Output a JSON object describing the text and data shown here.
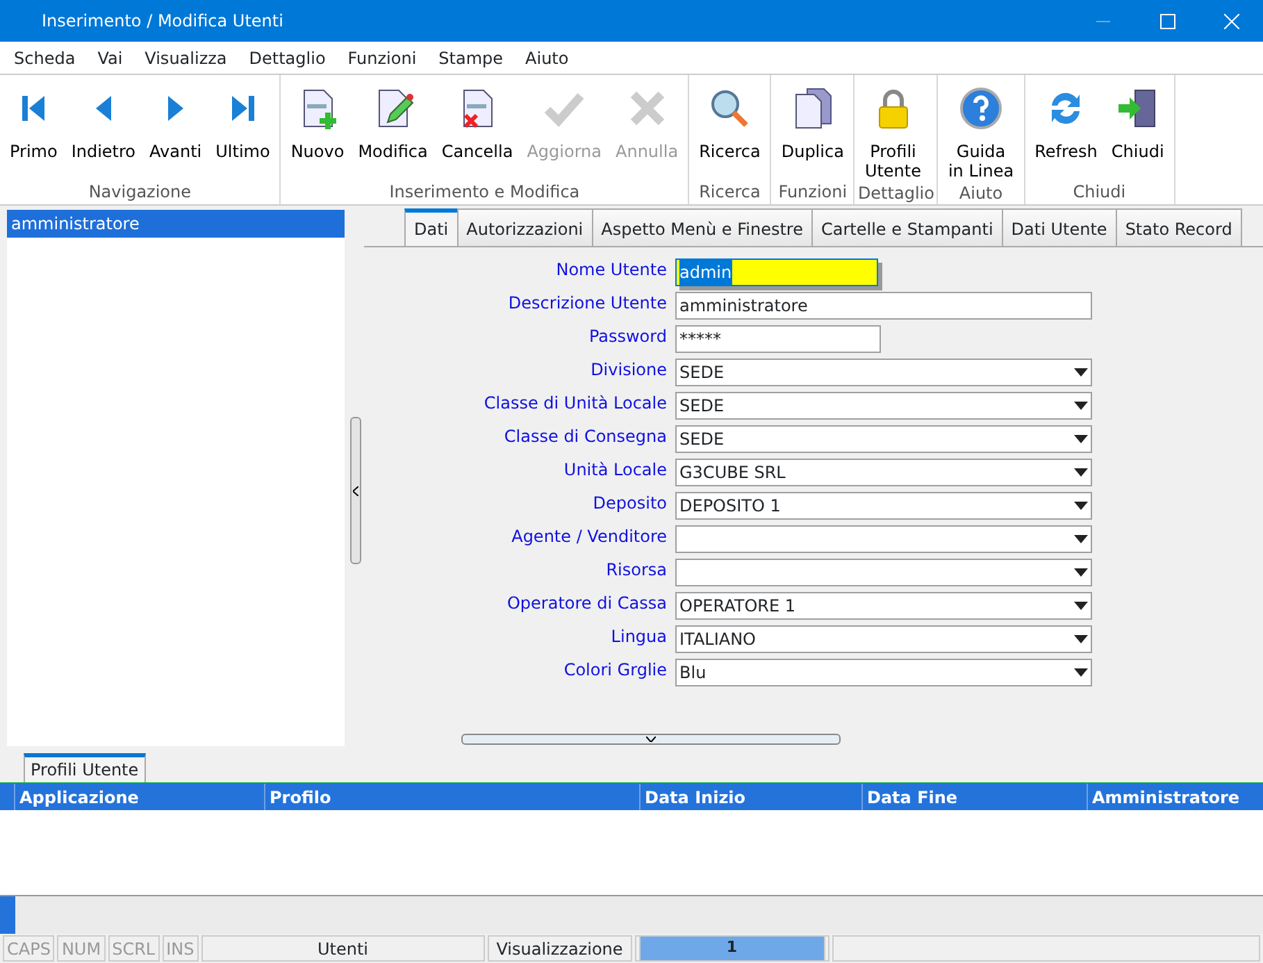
{
  "window": {
    "title": "Inserimento / Modifica Utenti"
  },
  "menu": [
    "Scheda",
    "Vai",
    "Visualizza",
    "Dettaglio",
    "Funzioni",
    "Stampe",
    "Aiuto"
  ],
  "ribbon": [
    {
      "label": "Navigazione",
      "buttons": [
        {
          "label": "Primo",
          "kind": "first",
          "disabled": false
        },
        {
          "label": "Indietro",
          "kind": "prev",
          "disabled": false
        },
        {
          "label": "Avanti",
          "kind": "next",
          "disabled": false
        },
        {
          "label": "Ultimo",
          "kind": "last",
          "disabled": false
        }
      ]
    },
    {
      "label": "Inserimento e Modifica",
      "buttons": [
        {
          "label": "Nuovo",
          "kind": "new",
          "disabled": false
        },
        {
          "label": "Modifica",
          "kind": "edit",
          "disabled": false
        },
        {
          "label": "Cancella",
          "kind": "delete",
          "disabled": false
        },
        {
          "label": "Aggiorna",
          "kind": "check",
          "disabled": true
        },
        {
          "label": "Annulla",
          "kind": "cross",
          "disabled": true
        }
      ]
    },
    {
      "label": "Ricerca",
      "buttons": [
        {
          "label": "Ricerca",
          "kind": "search",
          "disabled": false
        }
      ]
    },
    {
      "label": "Funzioni",
      "buttons": [
        {
          "label": "Duplica",
          "kind": "duplicate",
          "disabled": false
        }
      ]
    },
    {
      "label": "Dettaglio",
      "buttons": [
        {
          "label": "Profili\nUtente",
          "kind": "lock",
          "disabled": false
        }
      ]
    },
    {
      "label": "Aiuto",
      "buttons": [
        {
          "label": "Guida\nin Linea",
          "kind": "help",
          "disabled": false
        }
      ]
    },
    {
      "label": "Chiudi",
      "buttons": [
        {
          "label": "Refresh",
          "kind": "refresh",
          "disabled": false
        },
        {
          "label": "Chiudi",
          "kind": "exit",
          "disabled": false
        }
      ]
    }
  ],
  "user_list": [
    {
      "label": "amministratore",
      "selected": true
    }
  ],
  "tabs": [
    {
      "label": "Dati",
      "selected": true
    },
    {
      "label": "Autorizzazioni",
      "selected": false
    },
    {
      "label": "Aspetto Menù e Finestre",
      "selected": false
    },
    {
      "label": "Cartelle e Stampanti",
      "selected": false
    },
    {
      "label": "Dati Utente",
      "selected": false
    },
    {
      "label": "Stato Record",
      "selected": false
    }
  ],
  "fields": [
    {
      "label": "Nome Utente",
      "value": "admin",
      "kind": "focused"
    },
    {
      "label": "Descrizione Utente",
      "value": "amministratore",
      "kind": "text"
    },
    {
      "label": "Password",
      "value": "*****",
      "kind": "password"
    },
    {
      "label": "Divisione",
      "value": "SEDE",
      "kind": "combo"
    },
    {
      "label": "Classe di Unità Locale",
      "value": "SEDE",
      "kind": "combo"
    },
    {
      "label": "Classe di Consegna",
      "value": "SEDE",
      "kind": "combo"
    },
    {
      "label": "Unità Locale",
      "value": "G3CUBE SRL",
      "kind": "combo"
    },
    {
      "label": "Deposito",
      "value": "DEPOSITO 1",
      "kind": "combo"
    },
    {
      "label": "Agente / Venditore",
      "kind": "combo"
    },
    {
      "label": "Risorsa",
      "kind": "combo"
    },
    {
      "label": "Operatore di Cassa",
      "value": "OPERATORE 1",
      "kind": "combo"
    },
    {
      "label": "Lingua",
      "value": "ITALIANO",
      "kind": "combo"
    },
    {
      "label": "Colori Grglie",
      "value": "Blu",
      "kind": "combo"
    }
  ],
  "detail_tab": {
    "label": "Profili Utente",
    "selected": true
  },
  "grid": {
    "columns": [
      "Applicazione",
      "Profilo",
      "Data Inizio",
      "Data Fine",
      "Amministratore"
    ]
  },
  "status_bar": {
    "keys": [
      {
        "label": "CAPS",
        "on": false
      },
      {
        "label": "NUM",
        "on": false
      },
      {
        "label": "SCRL",
        "on": false
      },
      {
        "label": "INS",
        "on": false
      }
    ],
    "panels": [
      "Utenti",
      "Visualizzazione"
    ],
    "record": "1"
  }
}
